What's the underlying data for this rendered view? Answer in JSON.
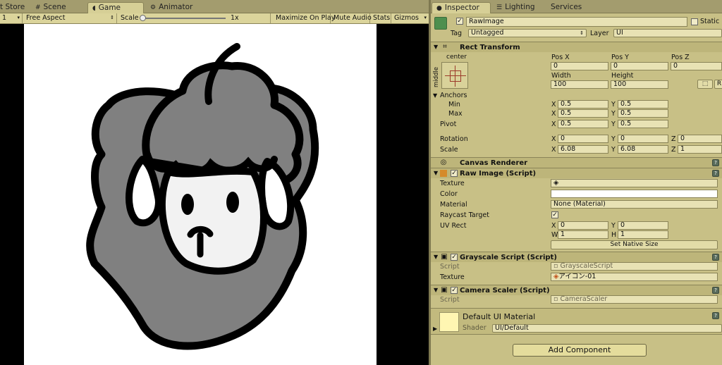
{
  "tabs": {
    "left": [
      {
        "label": "t Store",
        "icon": "store-icon"
      },
      {
        "label": "Scene",
        "icon": "scene-grid-icon"
      },
      {
        "label": "Game",
        "icon": "game-pacman-icon"
      },
      {
        "label": "Animator",
        "icon": "animator-icon"
      }
    ],
    "right": [
      {
        "label": "Inspector",
        "icon": "info-icon"
      },
      {
        "label": "Lighting",
        "icon": "lighting-icon"
      },
      {
        "label": "Services"
      }
    ]
  },
  "game_toolbar": {
    "display": "1",
    "aspect": "Free Aspect",
    "scale_label": "Scale",
    "scale_value": "1x",
    "maximize": "Maximize On Play",
    "mute": "Mute Audio",
    "stats": "Stats",
    "gizmos": "Gizmos"
  },
  "inspector": {
    "object_name": "RawImage",
    "static_label": "Static",
    "tag_label": "Tag",
    "tag_value": "Untagged",
    "layer_label": "Layer",
    "layer_value": "UI",
    "rect_transform": {
      "title": "Rect Transform",
      "anchor_h": "center",
      "anchor_v": "middle",
      "posx_label": "Pos X",
      "posy_label": "Pos Y",
      "posz_label": "Pos Z",
      "posx": "0",
      "posy": "0",
      "posz": "0",
      "width_label": "Width",
      "height_label": "Height",
      "width": "100",
      "height": "100",
      "anchors_label": "Anchors",
      "min_label": "Min",
      "max_label": "Max",
      "min_x": "0.5",
      "min_y": "0.5",
      "max_x": "0.5",
      "max_y": "0.5",
      "pivot_label": "Pivot",
      "pivot_x": "0.5",
      "pivot_y": "0.5",
      "rotation_label": "Rotation",
      "rot_x": "0",
      "rot_y": "0",
      "rot_z": "0",
      "scale_label": "Scale",
      "scale_x": "6.08",
      "scale_y": "6.08",
      "scale_z": "1"
    },
    "canvas_renderer": {
      "title": "Canvas Renderer"
    },
    "raw_image": {
      "title": "Raw Image (Script)",
      "texture_label": "Texture",
      "color_label": "Color",
      "material_label": "Material",
      "material_value": "None (Material)",
      "raycast_label": "Raycast Target",
      "uvrect_label": "UV Rect",
      "uv_x": "0",
      "uv_y": "0",
      "uv_w": "1",
      "uv_h": "1",
      "native_size_button": "Set Native Size"
    },
    "grayscale": {
      "title": "Grayscale Script (Script)",
      "script_label": "Script",
      "script_value": "GrayscaleScript",
      "texture_label": "Texture",
      "texture_value": "アイコン-01"
    },
    "camera_scaler": {
      "title": "Camera Scaler (Script)",
      "script_label": "Script",
      "script_value": "CameraScaler"
    },
    "material": {
      "name": "Default UI Material",
      "shader_label": "Shader",
      "shader_value": "UI/Default"
    },
    "add_component": "Add Component",
    "axis": {
      "x": "X",
      "y": "Y",
      "z": "Z",
      "w": "W",
      "h": "H"
    }
  },
  "colors": {
    "panel_bg": "#c8c086",
    "header_bg": "#bdb57a",
    "sheep_wool": "#808080",
    "outline": "#000000"
  }
}
